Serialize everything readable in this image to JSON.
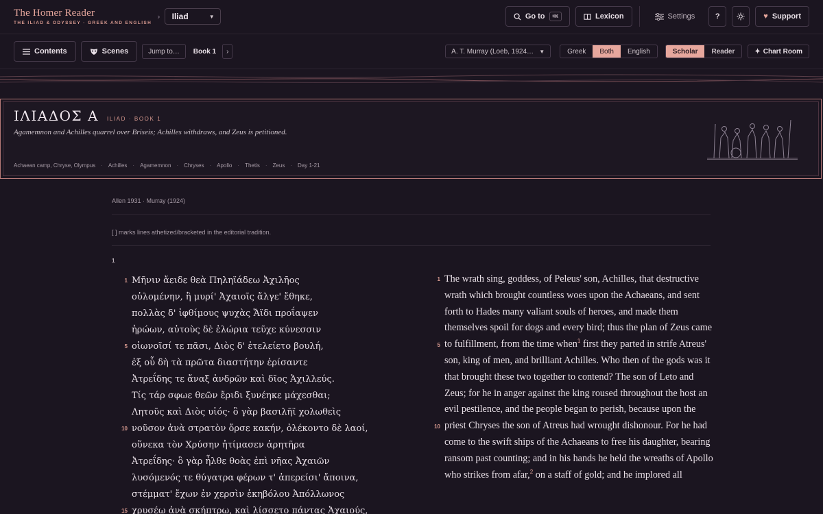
{
  "brand": {
    "title": "The Homer Reader",
    "subtitle": "THE ILIAD & ODYSSEY · GREEK AND ENGLISH"
  },
  "work_select": {
    "value": "Iliad"
  },
  "top_nav": {
    "goto_label": "Go to",
    "goto_shortcut": "⌘K",
    "lexicon_label": "Lexicon",
    "settings_label": "Settings",
    "help_label": "?",
    "support_label": "Support"
  },
  "toolbar": {
    "contents_label": "Contents",
    "scenes_label": "Scenes",
    "jump_label": "Jump to…",
    "book_label": "Book 1",
    "next_label": "›",
    "translation_value": "A. T. Murray (Loeb, 1924…",
    "lang_options": [
      "Greek",
      "Both",
      "English"
    ],
    "lang_active": "Both",
    "mode_options": [
      "Scholar",
      "Reader"
    ],
    "mode_active": "Scholar",
    "chart_room_label": "Chart Room"
  },
  "book_header": {
    "title": "ΙΛΙΑΔΟΣ Α",
    "subtitle": "ILIAD · BOOK 1",
    "description": "Agamemnon and Achilles quarrel over Briseis; Achilles withdraws, and Zeus is petitioned.",
    "tags": [
      "Achaean camp, Chryse, Olympus",
      "Achilles",
      "Agamemnon",
      "Chryses",
      "Apollo",
      "Thetis",
      "Zeus",
      "Day 1-21"
    ]
  },
  "reading": {
    "editions": "Allen 1931 · Murray (1924)",
    "bracket_note": "[ ] marks lines athetized/bracketed in the editorial tradition.",
    "section_number": "1",
    "greek_lines": [
      {
        "n": "1",
        "text": "Μῆνιν ἄειδε θεὰ Πηληϊάδεω Ἀχιλῆος"
      },
      {
        "n": "",
        "text": "οὐλομένην, ἣ μυρί' Ἀχαιοῖς ἄλγε' ἔθηκε,"
      },
      {
        "n": "",
        "text": "πολλὰς δ' ἰφθίμους ψυχὰς Ἄϊδι προΐαψεν"
      },
      {
        "n": "",
        "text": "ἡρώων, αὐτοὺς δὲ ἑλώρια τεῦχε κύνεσσιν"
      },
      {
        "n": "5",
        "text": "οἰωνοῖσί τε πᾶσι, Διὸς δ' ἐτελείετο βουλή,"
      },
      {
        "n": "",
        "text": "ἐξ οὗ δὴ τὰ πρῶτα διαστήτην ἐρίσαντε"
      },
      {
        "n": "",
        "text": "Ἀτρεΐδης τε ἄναξ ἀνδρῶν καὶ δῖος Ἀχιλλεύς."
      },
      {
        "n": "",
        "text": "Τίς τάρ σφωε θεῶν ἔριδι ξυνέηκε μάχεσθαι;"
      },
      {
        "n": "",
        "text": "Λητοῦς καὶ Διὸς υἱός· ὃ γὰρ βασιλῆϊ χολωθεὶς"
      },
      {
        "n": "10",
        "text": "νοῦσον ἀνὰ στρατὸν ὄρσε κακήν, ὀλέκοντο δὲ λαοί,"
      },
      {
        "n": "",
        "text": "οὕνεκα τὸν Χρύσην ἠτίμασεν ἀρητῆρα"
      },
      {
        "n": "",
        "text": "Ἀτρεΐδης· ὃ γὰρ ἦλθε θοὰς ἐπὶ νῆας Ἀχαιῶν"
      },
      {
        "n": "",
        "text": "λυσόμενός τε θύγατρα φέρων τ' ἀπερείσι' ἄποινα,"
      },
      {
        "n": "",
        "text": "στέμματ' ἔχων ἐν χερσὶν ἑκηβόλου Ἀπόλλωνος"
      },
      {
        "n": "15",
        "text": "χρυσέῳ ἀνὰ σκήπτρῳ, καὶ λίσσετο πάντας Ἀχαιούς,"
      }
    ],
    "english": {
      "p1": "The wrath sing, goddess, of Peleus' son, Achilles, that destructive wrath which brought countless woes upon the Achaeans, and sent forth to Hades many valiant souls of heroes, and made them themselves spoil for dogs and every bird; thus the plan of Zeus came to fulfillment, from the time when",
      "fn1": "1",
      "p2": " first they parted in strife Atreus' son, king of men, and brilliant Achilles. Who then of the gods was it that brought these two together to contend? The son of Leto and Zeus; for he in anger against the king roused throughout the host an evil pestilence, and the people began to perish, because upon the priest Chryses the son of Atreus had wrought dishonour. For he had come to the swift ships of the Achaeans to free his daughter, bearing ransom past counting; and in his hands he held the wreaths of Apollo who strikes from afar,",
      "fn2": "2",
      "p3": " on a staff of gold; and he implored all",
      "line_markers": [
        {
          "n": "1"
        },
        {
          "n": "5"
        },
        {
          "n": "10"
        }
      ]
    }
  },
  "colors": {
    "background": "#1b1520",
    "accent": "#e7a79d",
    "text": "#e8dfe6"
  }
}
